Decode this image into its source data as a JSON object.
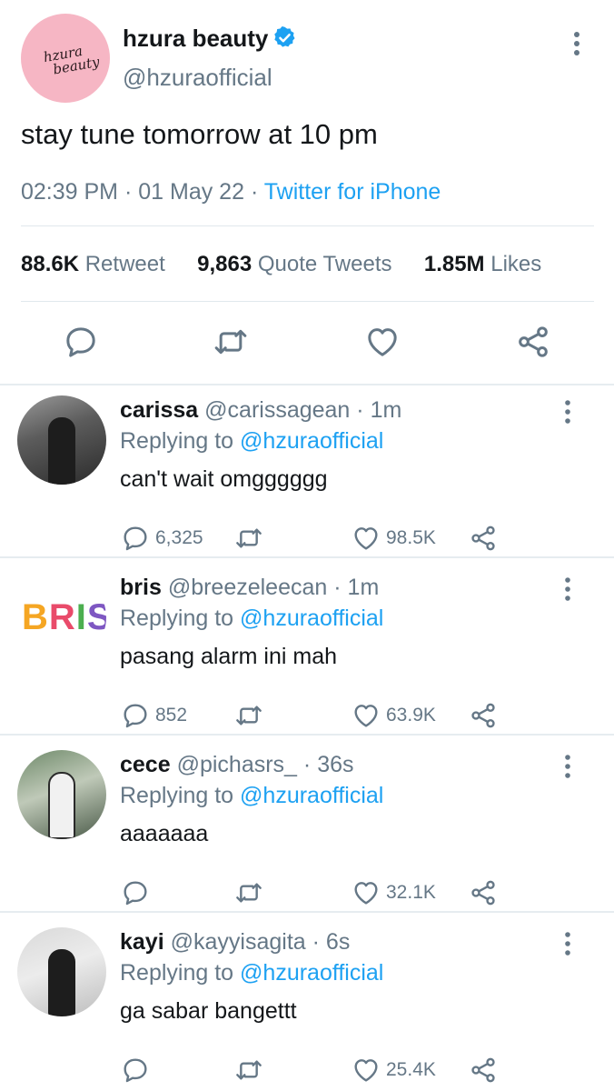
{
  "main_tweet": {
    "author_name": "hzura beauty",
    "author_handle": "@hzuraofficial",
    "avatar_logo_line1": "hzura",
    "avatar_logo_line2": "beauty",
    "text": "stay tune tomorrow at 10 pm",
    "time": "02:39 PM",
    "date": "01 May 22",
    "source": "Twitter for iPhone",
    "stats": {
      "retweets_count": "88.6K",
      "retweets_label": "Retweet",
      "quotes_count": "9,863",
      "quotes_label": "Quote Tweets",
      "likes_count": "1.85M",
      "likes_label": "Likes"
    },
    "actions": [
      "reply-icon",
      "retweet-icon",
      "like-icon",
      "share-icon"
    ]
  },
  "replies": [
    {
      "name": "carissa",
      "handle": "@carissagean",
      "time": "1m",
      "replying_prefix": "Replying to",
      "replying_to": "@hzuraofficial",
      "text": "can't wait omgggggg",
      "reply_count": "6,325",
      "like_count": "98.5K"
    },
    {
      "name": "bris",
      "handle": "@breezeleecan",
      "time": "1m",
      "replying_prefix": "Replying to",
      "replying_to": "@hzuraofficial",
      "text": "pasang alarm ini mah",
      "reply_count": "852",
      "like_count": "63.9K",
      "avatar_text": "BRIS"
    },
    {
      "name": "cece",
      "handle": "@pichasrs_",
      "time": "36s",
      "replying_prefix": "Replying to",
      "replying_to": "@hzuraofficial",
      "text": "aaaaaaa",
      "reply_count": "",
      "like_count": "32.1K"
    },
    {
      "name": "kayi",
      "handle": "@kayyisagita",
      "time": "6s",
      "replying_prefix": "Replying to",
      "replying_to": "@hzuraofficial",
      "text": "ga sabar bangettt",
      "reply_count": "",
      "like_count": "25.4K"
    }
  ],
  "colors": {
    "link_blue": "#1da1f2",
    "secondary_text": "#657786",
    "primary_text": "#14171a",
    "avatar_pink": "#f6b6c4"
  }
}
